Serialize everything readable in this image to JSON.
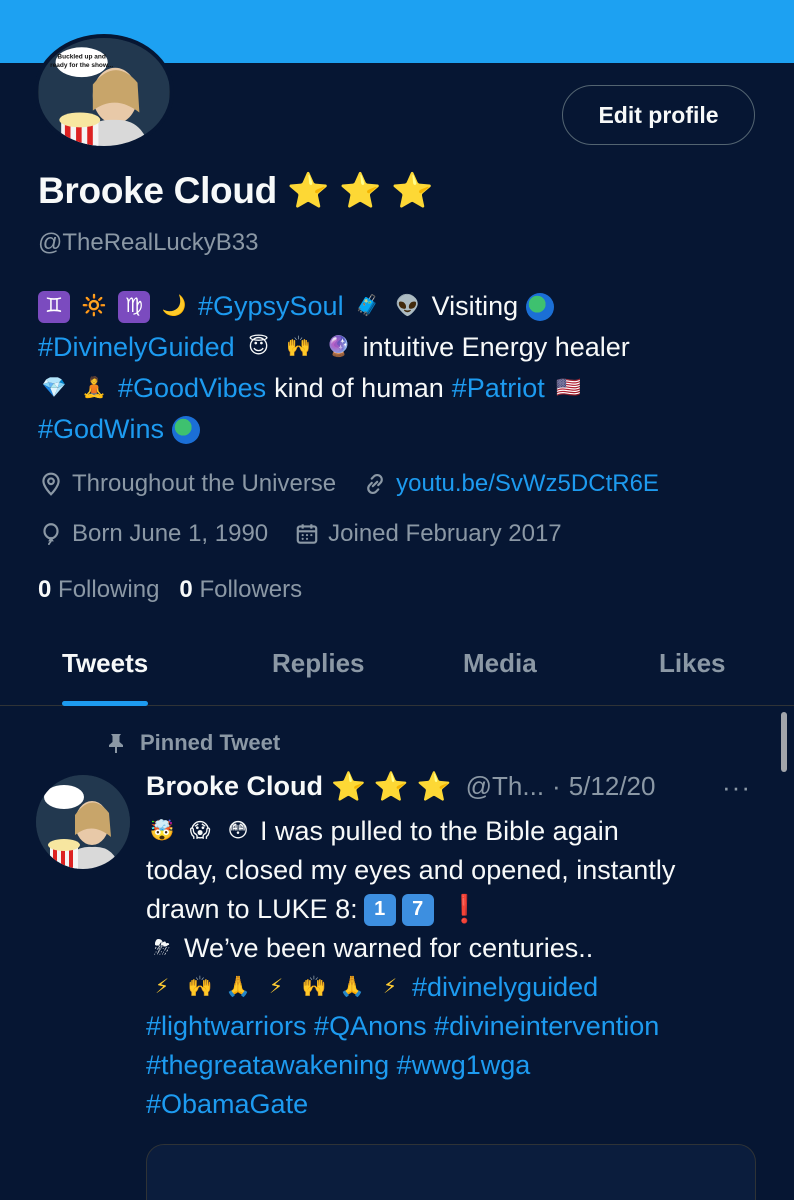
{
  "header": {
    "edit_profile_label": "Edit profile"
  },
  "profile": {
    "name": "Brooke Cloud",
    "name_stars": [
      "⭐",
      "⭐",
      "⭐"
    ],
    "handle": "@TheRealLuckyB33",
    "avatar_caption": "Buckled up and ready for the show...",
    "bio": {
      "l1_gemini": "♊",
      "l1_sun": "🔆",
      "l1_virgo": "♍",
      "l1_moon": "🌙",
      "l1_tag": "#GypsySoul",
      "l1_luggage": "🧳",
      "l1_alien": "👽",
      "l1_text": "Visiting",
      "l2_tag": "#DivinelyGuided",
      "l2_angel": "😇",
      "l2_hands": "🙌",
      "l2_crystal": "🔮",
      "l2_text": "intuitive Energy healer",
      "l3_gem": "💎",
      "l3_lotus": "🧘",
      "l3_tag": "#GoodVibes",
      "l3_text": "kind of human",
      "l3_tag2": "#Patriot",
      "l3_flag": "🇺🇸",
      "l4_tag": "#GodWins"
    },
    "location": "Throughout the Universe",
    "website": "youtu.be/SvWz5DCtR6E",
    "birthday": "Born June 1, 1990",
    "joined": "Joined February 2017",
    "following_count": "0",
    "following_label": "Following",
    "followers_count": "0",
    "followers_label": "Followers"
  },
  "tabs": [
    {
      "label": "Tweets",
      "active": true
    },
    {
      "label": "Replies",
      "active": false
    },
    {
      "label": "Media",
      "active": false
    },
    {
      "label": "Likes",
      "active": false
    }
  ],
  "pinned_tweet": {
    "pinned_label": "Pinned Tweet",
    "author_name": "Brooke Cloud",
    "author_handle": "@Th...",
    "date": "5/12/20",
    "more": "···",
    "body": {
      "e1": "🤯",
      "e2": "😱",
      "e3": "😳",
      "l1_text": "I was pulled to the Bible again",
      "l2_text": "today, closed my eyes and opened, instantly",
      "l3_text": "drawn to LUKE 8:",
      "key1": "1",
      "key2": "7",
      "exclaim": "❗",
      "storm": "⛈",
      "l4_text": "We’ve been warned for centuries..",
      "bolt": "⚡",
      "hands": "🙌",
      "pray": "🙏",
      "l5_tag": "#divinelyguided",
      "l6_text": "#lightwarriors #QAnons #divineintervention",
      "l7_text": "#thegreatawakening #wwg1wga",
      "l8_text": "#ObamaGate"
    }
  },
  "colors": {
    "background": "#061633",
    "banner": "#1da1f2",
    "accent": "#1d9bf0",
    "muted": "#8b98a5"
  },
  "icons": [
    "location-icon",
    "link-icon",
    "balloon-icon",
    "calendar-icon",
    "pin-icon",
    "more-icon"
  ]
}
